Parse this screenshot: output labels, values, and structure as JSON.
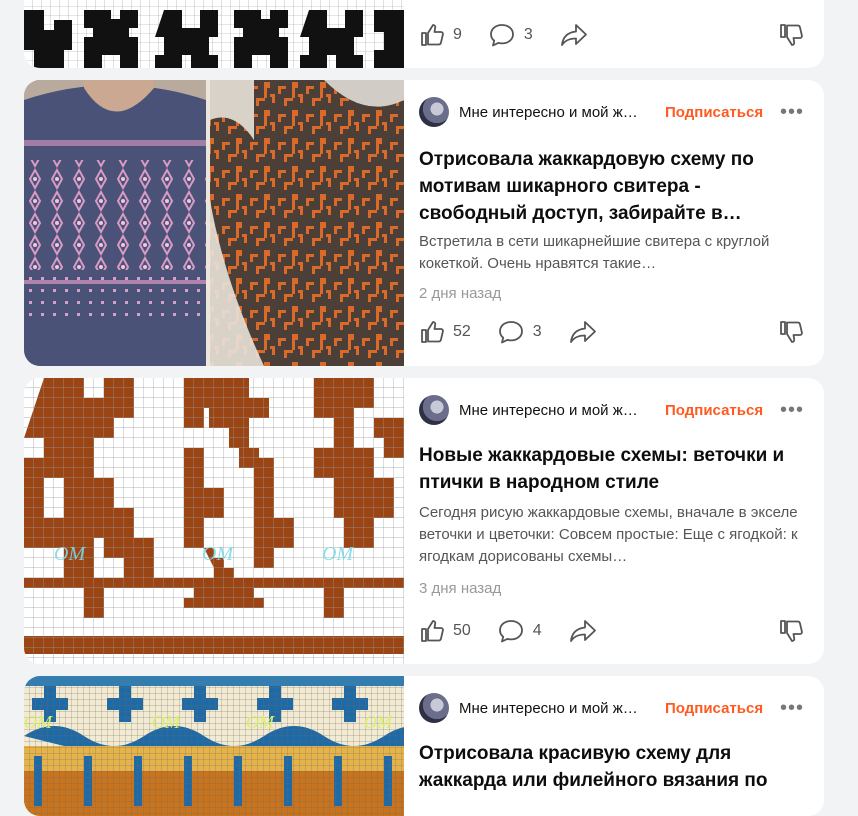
{
  "colors": {
    "accent": "#ff5a1f",
    "background": "#f2f3f5",
    "card": "#ffffff",
    "muted_text": "#555555",
    "date_text": "#999999"
  },
  "feed": {
    "top_card": {
      "likes": "9",
      "comments": "3"
    },
    "posts": [
      {
        "channel": "Мне интересно и мой ж…",
        "subscribe_label": "Подписаться",
        "more_label": "•••",
        "title": "Отрисовала жаккардовую схему по мотивам шикарного свитера - свободный доступ, забирайте в…",
        "snippet": "Встретила в сети шикарнейшие свитера с круглой кокеткой. Очень нравятся такие…",
        "date": "2 дня назад",
        "likes": "52",
        "comments": "3",
        "image": "photo of two jacquard sweaters"
      },
      {
        "channel": "Мне интересно и мой ж…",
        "subscribe_label": "Подписаться",
        "more_label": "•••",
        "title": "Новые жаккардовые схемы: веточки и птички в народном стиле",
        "snippet": "Сегодня рисую жаккардовые схемы, вначале в экселе веточки и цветочки: Совсем простые: Еще с ягодкой: к ягодкам дорисованы схемы…",
        "date": "3 дня назад",
        "likes": "50",
        "comments": "4",
        "image": "brown jacquard knitting chart",
        "watermark": "ОМ"
      },
      {
        "channel": "Мне интересно и мой ж…",
        "subscribe_label": "Подписаться",
        "more_label": "•••",
        "title": "Отрисовала красивую схему для жаккарда или филейного вязания по",
        "image": "blue and yellow jacquard chart",
        "watermark": "ОМ"
      }
    ]
  },
  "icons": {
    "like": "thumbs-up-icon",
    "comment": "comment-bubble-icon",
    "share": "share-arrow-icon",
    "dislike": "thumbs-down-icon"
  }
}
